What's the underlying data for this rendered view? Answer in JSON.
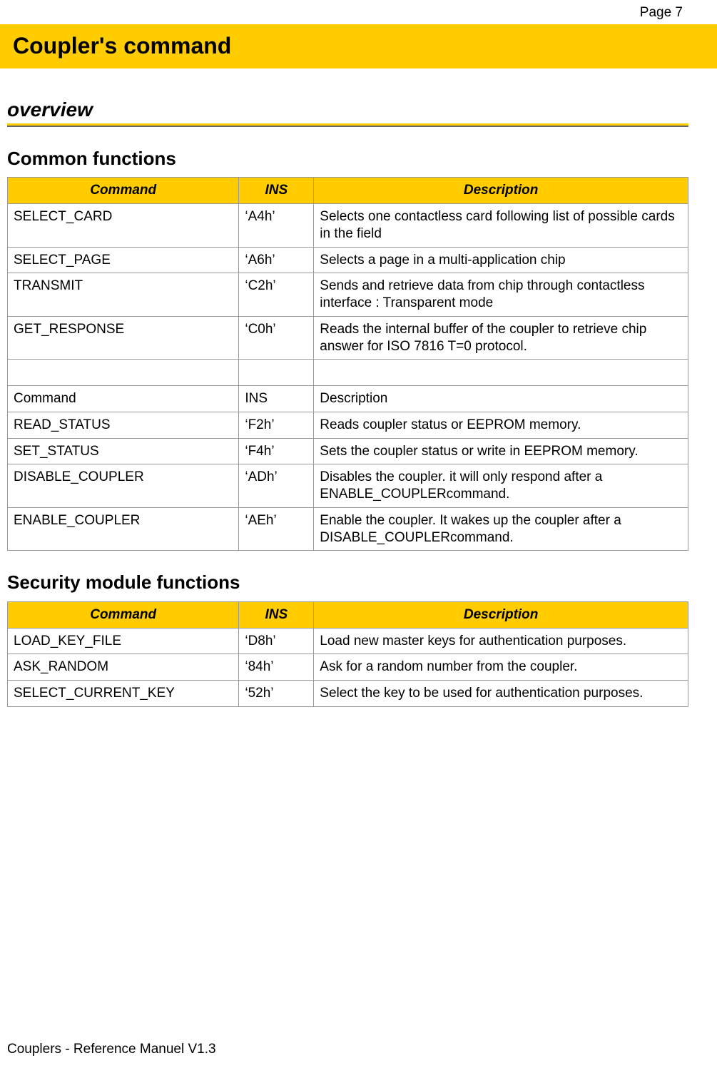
{
  "page_number": "Page 7",
  "title": "Coupler's command",
  "overview_heading": "overview",
  "sections": {
    "common": {
      "heading": "Common functions",
      "columns": [
        "Command",
        "INS",
        "Description"
      ],
      "rows": [
        {
          "cmd": "SELECT_CARD",
          "ins": "‘A4h’",
          "desc": "Selects one contactless card following list of possible cards in the field"
        },
        {
          "cmd": "SELECT_PAGE",
          "ins": "‘A6h’",
          "desc": "Selects a page in a multi-application chip"
        },
        {
          "cmd": "TRANSMIT",
          "ins": "‘C2h’",
          "desc": "Sends and retrieve data from chip through contactless interface : Transparent mode"
        },
        {
          "cmd": "GET_RESPONSE",
          "ins": "‘C0h’",
          "desc": "Reads the internal buffer of the coupler to retrieve chip answer for ISO 7816  T=0 protocol."
        },
        {
          "cmd": "",
          "ins": "",
          "desc": ""
        },
        {
          "cmd": "Command",
          "ins": "INS",
          "desc": "Description"
        },
        {
          "cmd": "READ_STATUS",
          "ins": "‘F2h’",
          "desc": "Reads coupler status or EEPROM memory."
        },
        {
          "cmd": "SET_STATUS",
          "ins": "‘F4h’",
          "desc": "Sets the coupler status or write in EEPROM memory."
        },
        {
          "cmd": "DISABLE_COUPLER",
          "ins": "‘ADh’",
          "desc": "Disables the coupler. it will only respond after a ENABLE_COUPLERcommand."
        },
        {
          "cmd": "ENABLE_COUPLER",
          "ins": "‘AEh’",
          "desc": "Enable the coupler. It wakes up the coupler after a DISABLE_COUPLERcommand."
        }
      ]
    },
    "security": {
      "heading": "Security module functions",
      "columns": [
        "Command",
        "INS",
        "Description"
      ],
      "rows": [
        {
          "cmd": "LOAD_KEY_FILE",
          "ins": "‘D8h’",
          "desc": "Load new master keys for authentication purposes."
        },
        {
          "cmd": "ASK_RANDOM",
          "ins": "‘84h’",
          "desc": "Ask for a random number from the coupler."
        },
        {
          "cmd": "SELECT_CURRENT_KEY",
          "ins": "‘52h’",
          "desc": "Select the key to be used for authentication purposes."
        }
      ]
    }
  },
  "footer": "Couplers - Reference Manuel V1.3"
}
